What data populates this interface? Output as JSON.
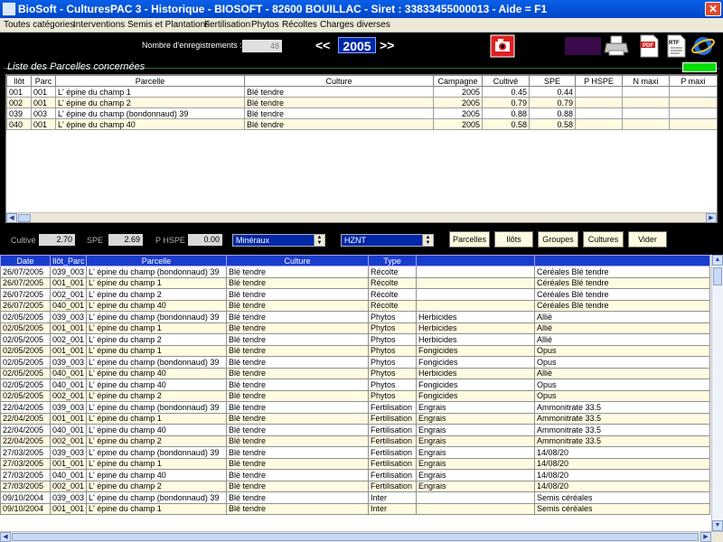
{
  "window": {
    "title": "BioSoft - CulturesPAC 3 - Historique   - BIOSOFT - 82600 BOUILLAC - Siret : 33833455000013 - Aide = F1",
    "close_glyph": "✕"
  },
  "menu": [
    "Toutes catégories",
    "Interventions",
    "Semis et Plantations",
    "Fertilisation",
    "Phytos",
    "Récoltes",
    "Charges diverses"
  ],
  "toolbar": {
    "records_label": "Nombre d'enregistrements :",
    "records_value": "48",
    "prev_year": "<<",
    "year": "2005",
    "next_year": ">>",
    "icons": [
      "camera-icon",
      "blank-icon",
      "printer-icon",
      "pdf-icon",
      "rtf-icon",
      "internet-explorer-icon"
    ]
  },
  "parcels": {
    "group_title": "Liste des Parcelles concernées",
    "columns": [
      "Ilôt",
      "Parc",
      "Parcelle",
      "Culture",
      "Campagne",
      "Cultivé",
      "SPE",
      "P HSPE",
      "N maxi",
      "P maxi"
    ],
    "rows": [
      [
        "001",
        "001",
        "L' épine du champ 1",
        "Blé tendre",
        "2005",
        "0.45",
        "0.44",
        "",
        "",
        ""
      ],
      [
        "002",
        "001",
        "L' épine du champ 2",
        "Blé tendre",
        "2005",
        "0.79",
        "0.79",
        "",
        "",
        ""
      ],
      [
        "039",
        "003",
        "L' épine du champ (bondonnaud) 39",
        "Blé tendre",
        "2005",
        "0.88",
        "0.88",
        "",
        "",
        ""
      ],
      [
        "040",
        "001",
        "L' épine du champ 40",
        "Blé tendre",
        "2005",
        "0.58",
        "0.58",
        "",
        "",
        ""
      ]
    ]
  },
  "totals": {
    "cultive_label": "Cultivé",
    "cultive_value": "2.70",
    "spe_label": "SPE",
    "spe_value": "2.69",
    "phspe_label": "P HSPE",
    "phspe_value": "0.00",
    "combo1": "Minéraux",
    "combo2": "HZNT",
    "buttons": [
      "Parcelles",
      "Ilôts",
      "Groupes",
      "Cultures",
      "Vider"
    ]
  },
  "history": {
    "columns": [
      "Date",
      "Ilôt_Parc",
      "Parcelle",
      "Culture",
      "Type",
      "",
      ""
    ],
    "rows": [
      [
        "26/07/2005",
        "039_003",
        "L' épine du champ (bondonnaud) 39",
        "Blé tendre",
        "Récolte",
        "",
        "Céréales Blé tendre"
      ],
      [
        "26/07/2005",
        "001_001",
        "L' épine du champ 1",
        "Blé tendre",
        "Récolte",
        "",
        "Céréales Blé tendre"
      ],
      [
        "26/07/2005",
        "002_001",
        "L' épine du champ 2",
        "Blé tendre",
        "Récolte",
        "",
        "Céréales Blé tendre"
      ],
      [
        "26/07/2005",
        "040_001",
        "L' épine du champ 40",
        "Blé tendre",
        "Récolte",
        "",
        "Céréales Blé tendre"
      ],
      [
        "02/05/2005",
        "039_003",
        "L' épine du champ (bondonnaud) 39",
        "Blé tendre",
        "Phytos",
        "Herbicides",
        "Allié"
      ],
      [
        "02/05/2005",
        "001_001",
        "L' épine du champ 1",
        "Blé tendre",
        "Phytos",
        "Herbicides",
        "Allié"
      ],
      [
        "02/05/2005",
        "002_001",
        "L' épine du champ 2",
        "Blé tendre",
        "Phytos",
        "Herbicides",
        "Allié"
      ],
      [
        "02/05/2005",
        "001_001",
        "L' épine du champ 1",
        "Blé tendre",
        "Phytos",
        "Fongicides",
        "Opus"
      ],
      [
        "02/05/2005",
        "039_003",
        "L' épine du champ (bondonnaud) 39",
        "Blé tendre",
        "Phytos",
        "Fongicides",
        "Opus"
      ],
      [
        "02/05/2005",
        "040_001",
        "L' épine du champ 40",
        "Blé tendre",
        "Phytos",
        "Herbicides",
        "Allié"
      ],
      [
        "02/05/2005",
        "040_001",
        "L' épine du champ 40",
        "Blé tendre",
        "Phytos",
        "Fongicides",
        "Opus"
      ],
      [
        "02/05/2005",
        "002_001",
        "L' épine du champ 2",
        "Blé tendre",
        "Phytos",
        "Fongicides",
        "Opus"
      ],
      [
        "22/04/2005",
        "039_003",
        "L' épine du champ (bondonnaud) 39",
        "Blé tendre",
        "Fertilisation",
        "Engrais",
        "Ammonitrate 33.5"
      ],
      [
        "22/04/2005",
        "001_001",
        "L' épine du champ 1",
        "Blé tendre",
        "Fertilisation",
        "Engrais",
        "Ammonitrate 33.5"
      ],
      [
        "22/04/2005",
        "040_001",
        "L' épine du champ 40",
        "Blé tendre",
        "Fertilisation",
        "Engrais",
        "Ammonitrate 33.5"
      ],
      [
        "22/04/2005",
        "002_001",
        "L' épine du champ 2",
        "Blé tendre",
        "Fertilisation",
        "Engrais",
        "Ammonitrate 33.5"
      ],
      [
        "27/03/2005",
        "039_003",
        "L' épine du champ (bondonnaud) 39",
        "Blé tendre",
        "Fertilisation",
        "Engrais",
        "14/08/20"
      ],
      [
        "27/03/2005",
        "001_001",
        "L' épine du champ 1",
        "Blé tendre",
        "Fertilisation",
        "Engrais",
        "14/08/20"
      ],
      [
        "27/03/2005",
        "040_001",
        "L' épine du champ 40",
        "Blé tendre",
        "Fertilisation",
        "Engrais",
        "14/08/20"
      ],
      [
        "27/03/2005",
        "002_001",
        "L' épine du champ 2",
        "Blé tendre",
        "Fertilisation",
        "Engrais",
        "14/08/20"
      ],
      [
        "09/10/2004",
        "039_003",
        "L' épine du champ (bondonnaud) 39",
        "Blé tendre",
        "Inter",
        "",
        "Semis céréales"
      ],
      [
        "09/10/2004",
        "001_001",
        "L' épine du champ 1",
        "Blé tendre",
        "Inter",
        "",
        "Semis céréales"
      ]
    ]
  }
}
